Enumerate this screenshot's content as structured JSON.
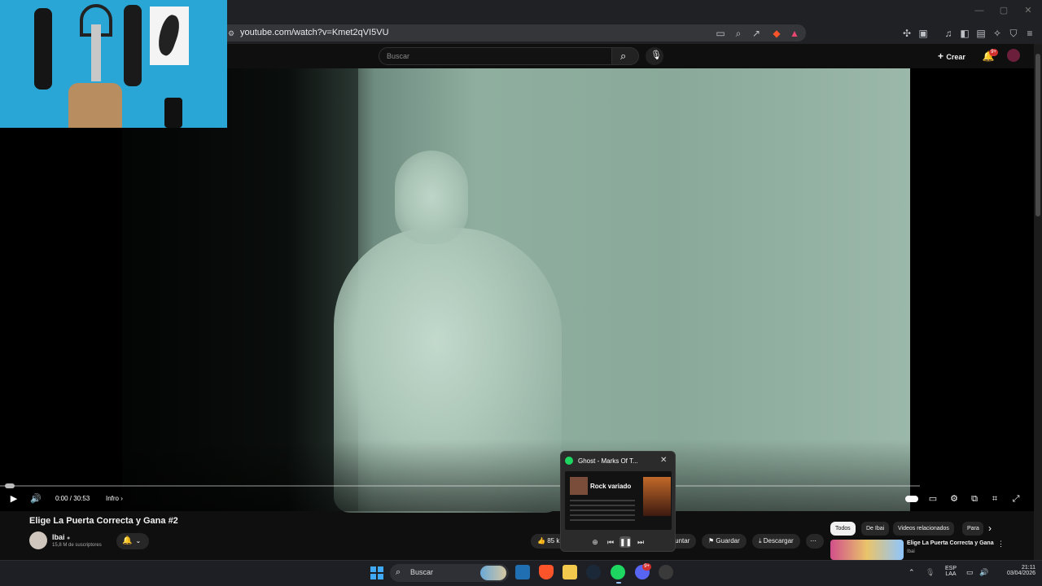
{
  "browser": {
    "url": "youtube.com/watch?v=Kmet2qVI5VU",
    "window_controls": [
      "—",
      "▢",
      "✕"
    ]
  },
  "youtube_header": {
    "search_placeholder": "Buscar",
    "create_label": "Crear",
    "notifications_badge": "9+"
  },
  "player": {
    "time": "0:00 / 30:53",
    "info_label": "Infro",
    "progress_fraction": 0.0
  },
  "video": {
    "title": "Elige La Puerta Correcta y Gana #2",
    "channel": "Ibai",
    "subscribers": "15,8 M de suscriptores",
    "like_count": "85 k",
    "actions": [
      "...guntar",
      "Guardar",
      "Descargar"
    ]
  },
  "sidebar": {
    "chips": [
      "Todos",
      "De Ibai",
      "Videos relacionados",
      "Para"
    ],
    "related_title": "Elige La Puerta Correcta y Gana",
    "related_channel": "Ibai"
  },
  "spotify_popup": {
    "track": "Ghost - Marks Of T...",
    "playlist_name": "Rock variado"
  },
  "taskbar": {
    "search_placeholder": "Buscar",
    "language": "ESP",
    "layout": "LAA",
    "time": "21:11",
    "date": "03/04/2026",
    "discord_badge": "9+"
  },
  "colors": {
    "yt_background": "#0f0f0f",
    "spotify_green": "#1ed760",
    "brave_orange": "#fb542b",
    "taskbar": "#1e1f24"
  }
}
